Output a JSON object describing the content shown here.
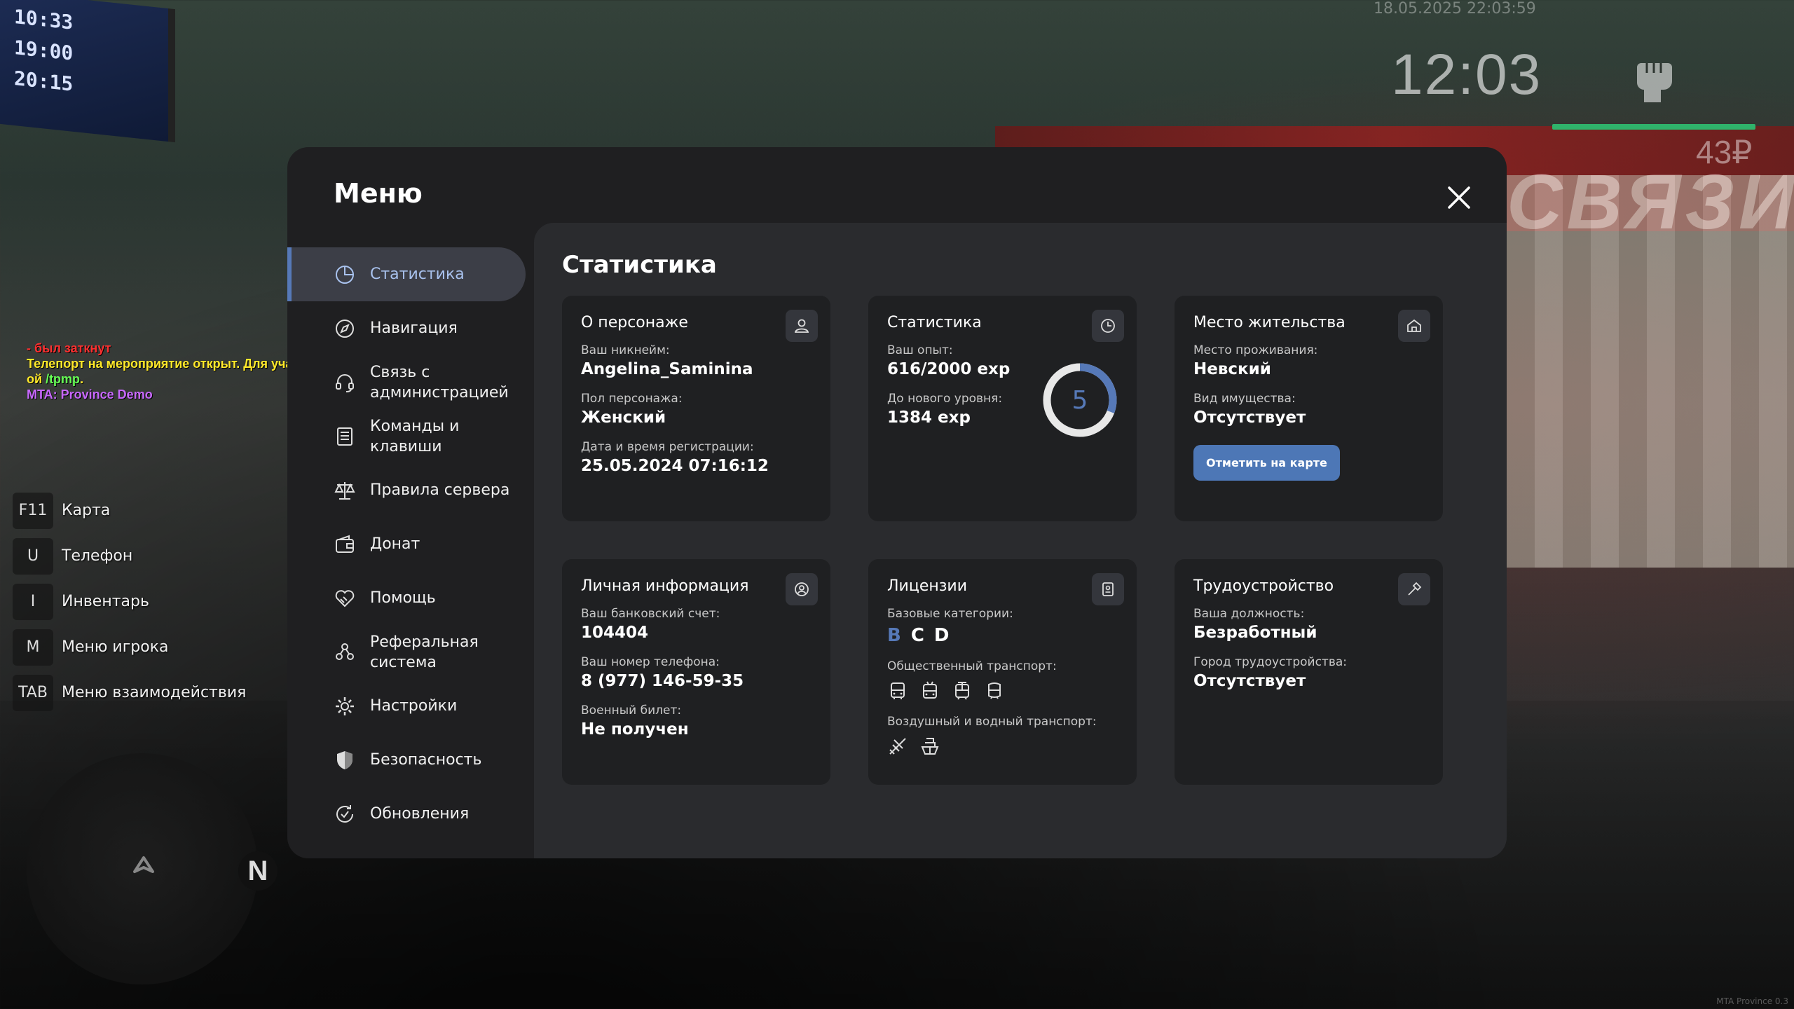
{
  "hud": {
    "datetime": "18.05.2025 22:03:59",
    "clock": "12:03",
    "money": "43₽"
  },
  "chat": {
    "line1": "- был заткнут",
    "line2": "Телепорт на мероприятие открыт. Для участия воспользуйтесь команд",
    "line3_prefix": "ой ",
    "line3_cmd": "/tpmp",
    "line3_suffix": ".",
    "line4": "MTA: Province Demo"
  },
  "keybinds": [
    {
      "key": "F11",
      "label": "Карта"
    },
    {
      "key": "U",
      "label": "Телефон"
    },
    {
      "key": "I",
      "label": "Инвентарь"
    },
    {
      "key": "M",
      "label": "Меню игрока"
    },
    {
      "key": "TAB",
      "label": "Меню взаимодействия"
    }
  ],
  "minimap": {
    "north": "N"
  },
  "watermark": "MTA Province 0.3",
  "menu": {
    "title": "Меню",
    "nav": [
      {
        "label": "Статистика",
        "icon": "pie-chart-icon",
        "active": true
      },
      {
        "label": "Навигация",
        "icon": "compass-icon"
      },
      {
        "label": "Связь с администрацией",
        "icon": "headset-icon"
      },
      {
        "label": "Команды и клавиши",
        "icon": "document-list-icon"
      },
      {
        "label": "Правила сервера",
        "icon": "scales-icon"
      },
      {
        "label": "Донат",
        "icon": "wallet-icon"
      },
      {
        "label": "Помощь",
        "icon": "handshake-heart-icon"
      },
      {
        "label": "Реферальная система",
        "icon": "people-network-icon"
      },
      {
        "label": "Настройки",
        "icon": "gear-icon"
      },
      {
        "label": "Безопасность",
        "icon": "shield-icon"
      },
      {
        "label": "Обновления",
        "icon": "refresh-check-icon"
      }
    ]
  },
  "content": {
    "title": "Статистика",
    "character": {
      "title": "О персонаже",
      "nickname_label": "Ваш никнейм:",
      "nickname": "Angelina_Saminina",
      "gender_label": "Пол персонажа:",
      "gender": "Женский",
      "reg_label": "Дата и время регистрации:",
      "reg": "25.05.2024 07:16:12"
    },
    "stats": {
      "title": "Статистика",
      "exp_label": "Ваш опыт:",
      "exp": "616/2000 exp",
      "next_label": "До нового уровня:",
      "next": "1384 exp",
      "level": "5",
      "progress": 0.308,
      "accent": "#5679b8"
    },
    "residence": {
      "title": "Место жительства",
      "place_label": "Место проживания:",
      "place": "Невский",
      "property_label": "Вид имущества:",
      "property": "Отсутствует",
      "button": "Отметить на карте"
    },
    "personal": {
      "title": "Личная информация",
      "bank_label": "Ваш банковский счет:",
      "bank": "104404",
      "phone_label": "Ваш номер телефона:",
      "phone": "8 (977) 146-59-35",
      "military_label": "Военный билет:",
      "military": "Не получен"
    },
    "licenses": {
      "title": "Лицензии",
      "basic_label": "Базовые категории:",
      "categories": [
        "B",
        "C",
        "D"
      ],
      "public_label": "Общественный транспорт:",
      "public_icons": [
        "bus-icon",
        "trolleybus-icon",
        "tram-icon",
        "metro-icon"
      ],
      "air_water_label": "Воздушный и водный транспорт:",
      "air_water_icons": [
        "plane-icon",
        "ship-icon"
      ]
    },
    "job": {
      "title": "Трудоустройство",
      "position_label": "Ваша должность:",
      "position": "Безработный",
      "city_label": "Город трудоустройства:",
      "city": "Отсутствует"
    }
  }
}
